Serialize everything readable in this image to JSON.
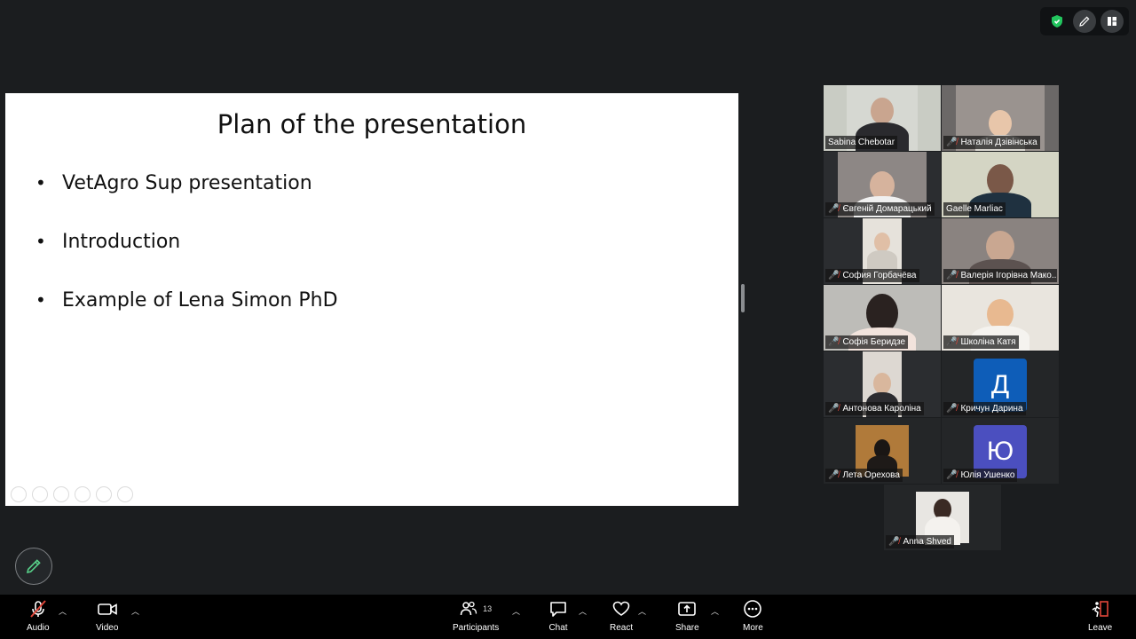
{
  "slide": {
    "title": "Plan of the presentation",
    "bullets": [
      "VetAgro Sup presentation",
      "Introduction",
      "Example of Lena Simon PhD"
    ]
  },
  "participants": [
    {
      "name": "Sabina Chebotar",
      "muted": false
    },
    {
      "name": "Наталія Дзівінська",
      "muted": true
    },
    {
      "name": "Євгеній Домарацький",
      "muted": true
    },
    {
      "name": "Gaelle Marliac",
      "muted": false,
      "active": true
    },
    {
      "name": "София Горбачёва",
      "muted": true
    },
    {
      "name": "Валерія Ігорівна Мако...",
      "muted": true
    },
    {
      "name": "Софія Беридзе",
      "muted": true
    },
    {
      "name": "Школіна Катя",
      "muted": true
    },
    {
      "name": "Антонова Кароліна",
      "muted": true
    },
    {
      "name": "Кричун Дарина",
      "muted": true,
      "avatar_letter": "Д"
    },
    {
      "name": "Лета Орехова",
      "muted": true
    },
    {
      "name": "Юлія Ушенко",
      "muted": true,
      "avatar_letter": "Ю"
    },
    {
      "name": "Anna Shved",
      "muted": true
    }
  ],
  "toolbar": {
    "audio_label": "Audio",
    "video_label": "Video",
    "participants_label": "Participants",
    "participants_count": "13",
    "chat_label": "Chat",
    "react_label": "React",
    "share_label": "Share",
    "more_label": "More",
    "leave_label": "Leave"
  },
  "colors": {
    "accent_green": "#58d38a",
    "muted_red": "#e0463a",
    "leave_red": "#e0463a",
    "avatar_blue": "#0e5db8",
    "avatar_purple": "#4b4fbf"
  },
  "icons": [
    "shield-icon",
    "pencil-icon",
    "layout-icon",
    "mic-off-icon",
    "camera-icon",
    "participants-icon",
    "chat-icon",
    "heart-icon",
    "share-screen-icon",
    "more-icon",
    "leave-icon"
  ]
}
